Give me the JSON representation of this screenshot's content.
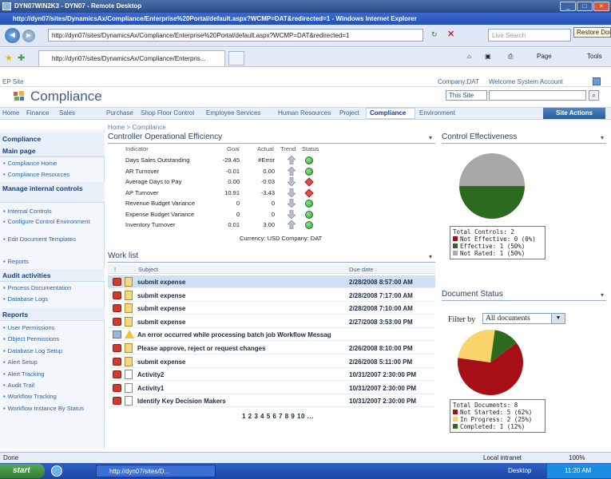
{
  "rdp": {
    "title": "DYN07WIN2K3 - DYN07 - Remote Desktop"
  },
  "ie": {
    "title": "http://dyn07/sites/DynamicsAx/Compliance/Enterprise%20Portal/default.aspx?WCMP=DAT&redirected=1 - Windows Internet Explorer",
    "address": "http://dyn07/sites/DynamicsAx/Compliance/Enterprise%20Portal/default.aspx?WCMP=DAT&redirected=1",
    "search_placeholder": "Live Search",
    "restore_tooltip": "Restore Down",
    "tab_label": "http://dyn07/sites/DynamicsAx/Compliance/Enterpris...",
    "cmd_page": "Page",
    "cmd_tools": "Tools"
  },
  "ep": {
    "site_label": "EP Site",
    "company": "Company:DAT",
    "welcome": "Welcome System Account",
    "title": "Compliance",
    "scope": "This Site",
    "site_actions": "Site Actions"
  },
  "nav": {
    "items": [
      "Home",
      "Finance",
      "Sales",
      "Purchase",
      "Shop Floor Control",
      "Employee Services",
      "Human Resources",
      "Project",
      "Compliance",
      "Environment"
    ],
    "breadcrumb": "Home > Compliance"
  },
  "leftnav": {
    "compliance": "Compliance",
    "main_page": "Main page",
    "main_items": [
      "Compliance Home",
      "Compliance Resources"
    ],
    "manage": "Manage internal controls",
    "manage_items": [
      "Internal Controls",
      "Configure Control Environment",
      "Edit Document Templates",
      "Reports"
    ],
    "audit": "Audit activities",
    "audit_items": [
      "Process Documentation",
      "Database Logs"
    ],
    "reports": "Reports",
    "report_items": [
      "User Permissions",
      "Object Permissions",
      "Database Log Setup",
      "Alert Setup",
      "Alert Tracking",
      "Audit Trail",
      "Workflow Tracking",
      "Workflow Instance By Status"
    ]
  },
  "kpi": {
    "title": "Controller Operational Efficiency",
    "headers": [
      "Indicator",
      "Goal",
      "Actual",
      "Trend",
      "Status"
    ],
    "rows": [
      {
        "indicator": "Days Sales Outstanding",
        "goal": "-29.45",
        "actual": "#Error",
        "trend": "up",
        "status": "green"
      },
      {
        "indicator": "AR Turnover",
        "goal": "-0.01",
        "actual": "0.00",
        "trend": "up",
        "status": "green"
      },
      {
        "indicator": "Average Days to Pay",
        "goal": "0.00",
        "actual": "-0.03",
        "trend": "down",
        "status": "red"
      },
      {
        "indicator": "AP Turnover",
        "goal": "10.91",
        "actual": "-3.43",
        "trend": "down",
        "status": "red"
      },
      {
        "indicator": "Revenue Budget Variance",
        "goal": "0",
        "actual": "0",
        "trend": "down",
        "status": "green"
      },
      {
        "indicator": "Expense Budget Variance",
        "goal": "0",
        "actual": "0",
        "trend": "down",
        "status": "green"
      },
      {
        "indicator": "Inventory Turnover",
        "goal": "0.01",
        "actual": "3.00",
        "trend": "up",
        "status": "green"
      }
    ],
    "footer": "Currency: USD Company: DAT"
  },
  "worklist": {
    "title": "Work list",
    "header_bang": "!",
    "header_subject": "Subject",
    "header_due": "Due date",
    "rows": [
      {
        "subject": "submit expense",
        "due": "2/28/2008 8:57:00 AM",
        "icon": "doc",
        "selected": true
      },
      {
        "subject": "submit expense",
        "due": "2/28/2008 7:17:00 AM",
        "icon": "doc"
      },
      {
        "subject": "submit expense",
        "due": "2/28/2008 7:10:00 AM",
        "icon": "doc"
      },
      {
        "subject": "submit expense",
        "due": "2/27/2008 3:53:00 PM",
        "icon": "doc"
      },
      {
        "subject": "An error occurred while processing batch job Workflow Messag",
        "due": "",
        "icon": "warn"
      },
      {
        "subject": "Please approve, reject or request changes",
        "due": "2/26/2008 8:10:00 PM",
        "icon": "doc"
      },
      {
        "subject": "submit expense",
        "due": "2/26/2008 5:11:00 PM",
        "icon": "doc"
      },
      {
        "subject": "Activity2",
        "due": "10/31/2007 2:30:00 PM",
        "icon": "act"
      },
      {
        "subject": "Activity1",
        "due": "10/31/2007 2:30:00 PM",
        "icon": "act"
      },
      {
        "subject": "Identify Key Decision Makers",
        "due": "10/31/2007 2:30:00 PM",
        "icon": "act"
      }
    ],
    "pager": "1 2 3 4 5 6 7 8 9 10 ..."
  },
  "control": {
    "title": "Control Effectiveness",
    "legend_title": "Total Controls: 2",
    "legend": [
      "Not Effective: 0 (0%)",
      "Effective: 1 (50%)",
      "Not Rated: 1 (50%)"
    ],
    "colors": [
      "#a50f15",
      "#2d6a1f",
      "#a8a8a8"
    ]
  },
  "docstatus": {
    "title": "Document Status",
    "filter_label": "Filter by",
    "filter_value": "All documents",
    "legend_title": "Total Documents: 8",
    "legend": [
      "Not Started: 5 (62%)",
      "In Progress: 2 (25%)",
      "Completed: 1 (12%)"
    ],
    "colors": [
      "#a50f15",
      "#f8d46b",
      "#2d6a1f"
    ]
  },
  "status": {
    "done": "Done",
    "zone": "Local intranet",
    "zoom": "100%"
  },
  "taskbar": {
    "start": "start",
    "item": "http://dyn07/sites/D...",
    "desktop": "Desktop",
    "time": "11:20 AM"
  }
}
